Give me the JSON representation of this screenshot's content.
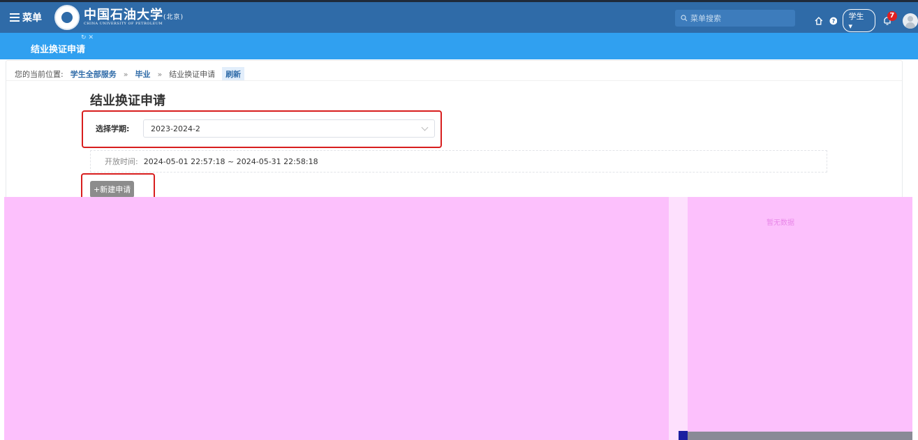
{
  "header": {
    "menu_label": "菜单",
    "logo_cn": "中国石油大学",
    "logo_cn_suffix": "(北京)",
    "logo_en": "CHINA UNIVERSITY OF PETROLEUM",
    "search_placeholder": "菜单搜索",
    "role_label": "学生",
    "notification_count": "7"
  },
  "tab": {
    "label": "结业换证申请"
  },
  "breadcrumb": {
    "prefix": "您的当前位置:",
    "items": [
      "学生全部服务",
      "毕业",
      "结业换证申请"
    ],
    "separator": "»",
    "refresh": "刷新"
  },
  "form": {
    "title": "结业换证申请",
    "term_label": "选择学期:",
    "term_value": "2023-2024-2",
    "open_time_label": "开放时间:",
    "open_time_value": "2024-05-01 22:57:18 ~ 2024-05-31 22:58:18",
    "new_button": "+新建申请"
  },
  "side": {
    "no_data": "暂无数据"
  },
  "colors": {
    "topbar": "#2f6ba8",
    "subbar": "#30a0f0",
    "highlight": "#d81e1e",
    "overlay": "#fcc0fc"
  }
}
